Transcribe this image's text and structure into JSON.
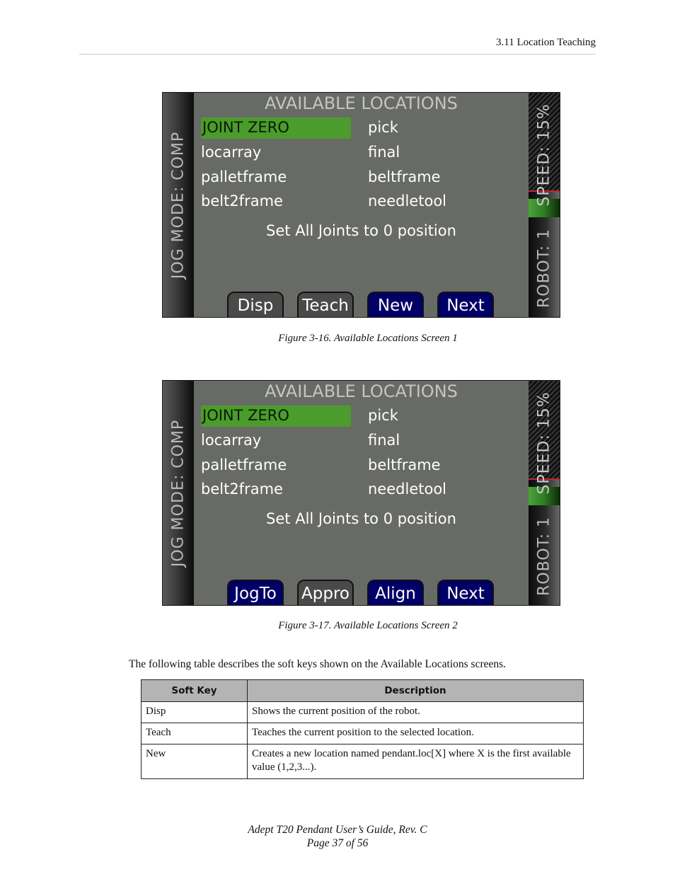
{
  "header": {
    "section": "3.11  Location Teaching"
  },
  "figures": [
    {
      "caption": "Figure 3-16. Available Locations Screen 1",
      "screen": {
        "title": "AVAILABLE LOCATIONS",
        "jog_mode": "JOG MODE: COMP",
        "speed": "SPEED: 15%",
        "robot": "ROBOT: 1",
        "locations": [
          "JOINT ZERO",
          "pick",
          "locarray",
          "final",
          "palletframe",
          "beltframe",
          "belt2frame",
          "needletool"
        ],
        "selected_location": "JOINT ZERO",
        "help_text": "Set All Joints to 0 position",
        "softkeys": [
          {
            "label": "Disp",
            "color": "#4a4a4a"
          },
          {
            "label": "Teach",
            "color": "#4a4a4a"
          },
          {
            "label": "New",
            "color": "#000066"
          },
          {
            "label": "Next >",
            "color": "#000066"
          }
        ]
      }
    },
    {
      "caption": "Figure 3-17. Available Locations Screen 2",
      "screen": {
        "title": "AVAILABLE LOCATIONS",
        "jog_mode": "JOG MODE: COMP",
        "speed": "SPEED: 15%",
        "robot": "ROBOT: 1",
        "locations": [
          "JOINT ZERO",
          "pick",
          "locarray",
          "final",
          "palletframe",
          "beltframe",
          "belt2frame",
          "needletool"
        ],
        "selected_location": "JOINT ZERO",
        "help_text": "Set All Joints to 0 position",
        "softkeys": [
          {
            "label": "JogTo",
            "color": "#000066"
          },
          {
            "label": "Appro",
            "color": "#4a4a4a"
          },
          {
            "label": "Align",
            "color": "#000066"
          },
          {
            "label": "Next >",
            "color": "#000066"
          }
        ]
      }
    }
  ],
  "intro": "The following table describes the soft keys shown on the Available Locations screens.",
  "table": {
    "headers": [
      "Soft Key",
      "Description"
    ],
    "rows": [
      [
        "Disp",
        "Shows the current position of the robot."
      ],
      [
        "Teach",
        "Teaches the current position to the selected location."
      ],
      [
        "New",
        "Creates a new location named pendant.loc[X] where X is the first available value (1,2,3...)."
      ]
    ]
  },
  "footer": {
    "title": "Adept T20 Pendant User’s Guide, Rev. C",
    "page": "Page 37 of 56"
  },
  "colors": {
    "screen_bg": "#686a66",
    "selection": "#4b9c2c",
    "softkey_blue": "#000066",
    "softkey_gray": "#4a4a4a",
    "speed_marker": "#c0282c"
  }
}
